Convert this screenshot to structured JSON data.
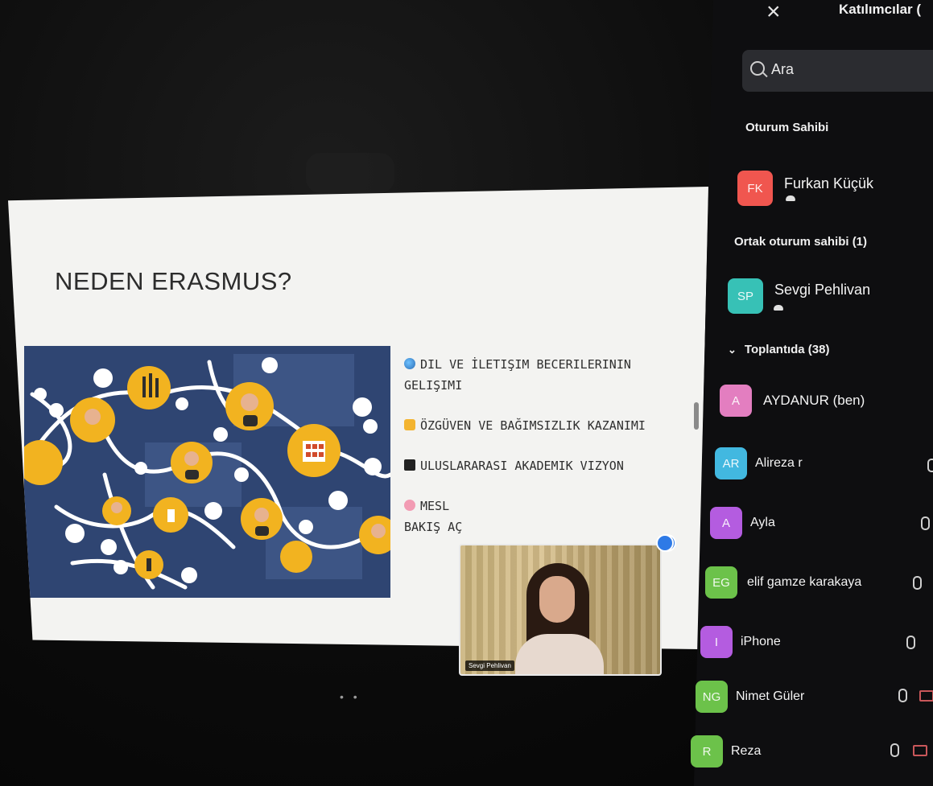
{
  "slide": {
    "title": "NEDEN ERASMUS?",
    "bullets": [
      {
        "icon": "globe-icon",
        "text": "DIL VE İLETIŞIM BECERILERININ GELIŞIMI"
      },
      {
        "icon": "flexed-arm-icon",
        "text": "ÖZGÜVEN VE BAĞIMSIZLIK KAZANIMI"
      },
      {
        "icon": "graduation-cap-icon",
        "text": "ULUSLARARASI AKADEMIK VIZYON"
      },
      {
        "icon": "brain-icon",
        "text": "MESL"
      }
    ],
    "bullet_trail": "BAKIŞ AÇ",
    "pager": "• •"
  },
  "self_video": {
    "label": "Sevgi Pehlivan"
  },
  "panel": {
    "title": "Katılımcılar (",
    "close_icon": "×",
    "search": {
      "placeholder": "Ara"
    },
    "sections": {
      "host": "Oturum Sahibi",
      "cohost": "Ortak oturum sahibi (1)",
      "in_meeting": "Toplantıda (38)"
    },
    "host": {
      "initials": "FK",
      "name": "Furkan Küçük",
      "color": "#f0564f"
    },
    "cohost": {
      "initials": "SP",
      "name": "Sevgi Pehlivan",
      "color": "#37c1b6"
    },
    "participants": [
      {
        "initials": "A",
        "name": "AYDANUR (ben)",
        "color": "#e37ec0"
      },
      {
        "initials": "AR",
        "name": "Alireza r",
        "color": "#42b8e0"
      },
      {
        "initials": "A",
        "name": "Ayla",
        "color": "#b45ce0"
      },
      {
        "initials": "EG",
        "name": "elif gamze karakaya",
        "color": "#6cc24a"
      },
      {
        "initials": "I",
        "name": "iPhone",
        "color": "#b45ce0"
      },
      {
        "initials": "NG",
        "name": "Nimet Güler",
        "color": "#6cc24a"
      },
      {
        "initials": "R",
        "name": "Reza",
        "color": "#6cc24a"
      }
    ]
  }
}
